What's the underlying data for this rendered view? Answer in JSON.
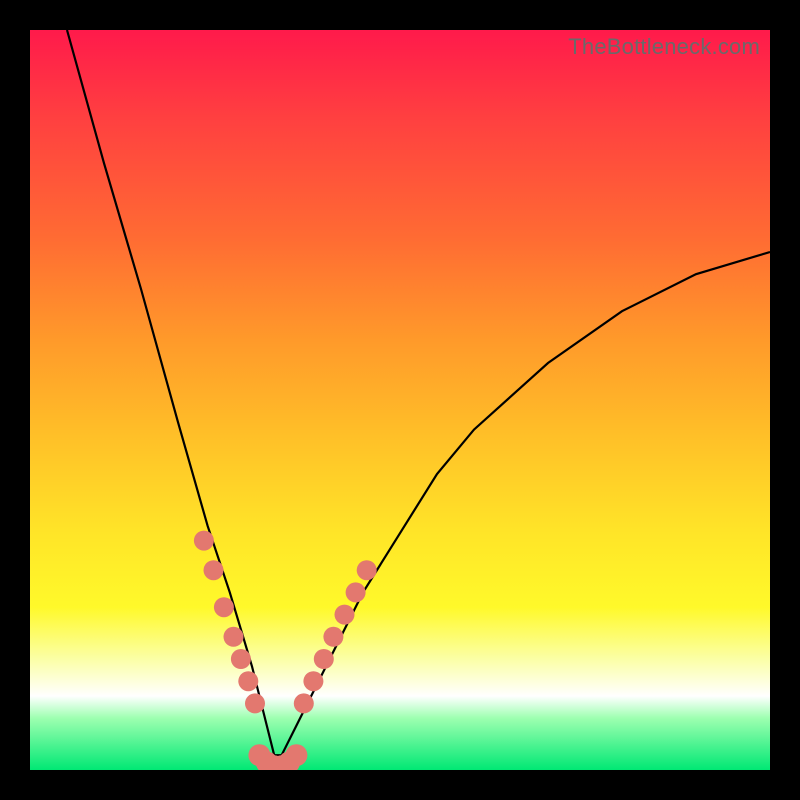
{
  "watermark": "TheBottleneck.com",
  "colors": {
    "dot": "#e3786f",
    "curve": "#000000",
    "gradient_top": "#ff1a4b",
    "gradient_bottom": "#00e874"
  },
  "chart_data": {
    "type": "line",
    "title": "",
    "xlabel": "",
    "ylabel": "",
    "xlim": [
      0,
      100
    ],
    "ylim": [
      0,
      100
    ],
    "grid": false,
    "notes": "V-shaped curve; y ≈ 100 at x≈5, drops to y≈0 near x≈33, rises to y≈70 at x=100. Salmon dots cluster along the lower portion of both branches near the valley.",
    "series": [
      {
        "name": "curve",
        "x": [
          5,
          10,
          15,
          20,
          24,
          27,
          30,
          32,
          33,
          34,
          36,
          40,
          45,
          50,
          55,
          60,
          70,
          80,
          90,
          100
        ],
        "values": [
          100,
          82,
          65,
          47,
          33,
          24,
          14,
          6,
          2,
          2,
          6,
          14,
          24,
          32,
          40,
          46,
          55,
          62,
          67,
          70
        ]
      },
      {
        "name": "dots-left-branch",
        "x": [
          23.5,
          24.8,
          26.2,
          27.5,
          28.5,
          29.5,
          30.4
        ],
        "values": [
          31,
          27,
          22,
          18,
          15,
          12,
          9
        ]
      },
      {
        "name": "dots-right-branch",
        "x": [
          37.0,
          38.3,
          39.7,
          41.0,
          42.5,
          44.0,
          45.5
        ],
        "values": [
          9,
          12,
          15,
          18,
          21,
          24,
          27
        ]
      },
      {
        "name": "dots-valley-floor",
        "x": [
          31.0,
          32.0,
          33.0,
          34.0,
          35.0,
          36.0
        ],
        "values": [
          2,
          1,
          0.5,
          0.5,
          1,
          2
        ]
      }
    ]
  }
}
